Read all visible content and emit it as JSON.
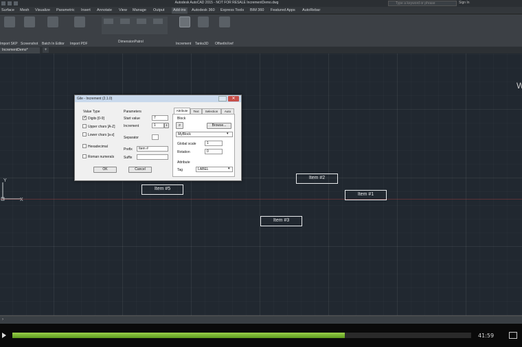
{
  "titlebar": {
    "title": "Autodesk AutoCAD 2015 - NOT FOR RESALE   IncrementDemo.dwg",
    "search_placeholder": "Type a keyword or phrase",
    "signin": "Sign In"
  },
  "ribbon_tabs": [
    "Surface",
    "Mesh",
    "Visualize",
    "Parametric",
    "Insert",
    "Annotate",
    "View",
    "Manage",
    "Output",
    "Add-ins",
    "Autodesk 360",
    "Express Tools",
    "BIM 360",
    "Featured Apps",
    "AutoRebar"
  ],
  "ribbon_active_tab": "Add-ins",
  "ribbon_buttons": [
    "Import SKP",
    "Screenshot",
    "Batch In Editor",
    "Import PDF",
    "DimensionPatrol",
    "Increment",
    "Tanks3D",
    "OffsetInXref"
  ],
  "file_tab": "IncrementDemo*",
  "canvas_items": [
    "Item #5",
    "Item #2",
    "Item #1",
    "Item #3"
  ],
  "dialog": {
    "title": "Gile - Increment (2.1.0)",
    "value_type_label": "Value Type",
    "value_types": [
      "Digits [0-9]",
      "Upper chars [A-Z]",
      "Lower chars [a-z]",
      "Hexadecimal",
      "Roman numerals"
    ],
    "parameters_label": "Parameters",
    "start_value_label": "Start value",
    "start_value": "7",
    "increment_label": "Increment",
    "increment_value": "1",
    "separator_label": "Separator",
    "prefix_label": "Prefix",
    "prefix_value": "Item #",
    "suffix_label": "Suffix",
    "ok": "OK",
    "cancel": "Cancel",
    "tabs": [
      "Attribute",
      "Text",
      "Selection",
      "Auto"
    ],
    "block_label": "Block",
    "browse": "Browse...",
    "block_name": "MyBlock",
    "global_scale_label": "Global scale",
    "global_scale": "1",
    "rotation_label": "Rotation",
    "rotation": "0",
    "attribute_label": "Attribute",
    "tag_label": "Tag",
    "tag_value": "LABEL"
  },
  "player": {
    "time": "41:59",
    "progress": 0.725
  }
}
